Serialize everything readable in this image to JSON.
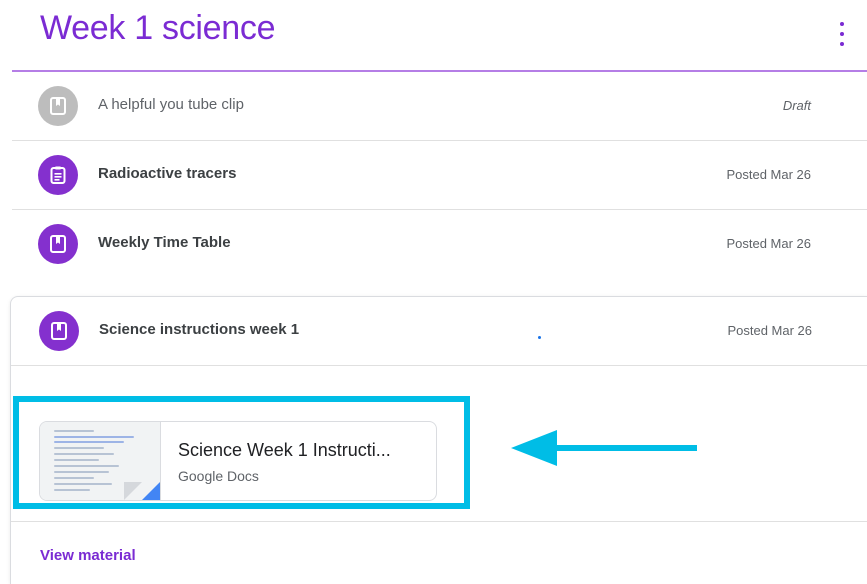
{
  "topic": {
    "title": "Week 1 science"
  },
  "items": [
    {
      "name": "A helpful you tube clip",
      "status": "Draft",
      "icon": "material-book-icon",
      "color": "#bdbdbd"
    },
    {
      "name": "Radioactive tracers",
      "status": "Posted Mar 26",
      "icon": "assignment-clipboard-icon",
      "color": "#8430ce"
    },
    {
      "name": "Weekly Time Table",
      "status": "Posted Mar 26",
      "icon": "material-book-icon",
      "color": "#8430ce"
    }
  ],
  "expanded_item": {
    "name": "Science instructions week 1",
    "status": "Posted Mar 26",
    "icon": "material-book-icon",
    "color": "#8430ce",
    "attachment": {
      "title": "Science Week 1 Instructi...",
      "type": "Google Docs",
      "icon": "google-docs-thumbnail"
    },
    "view_label": "View material"
  },
  "colors": {
    "accent": "#7b2bd3",
    "highlight": "#00bde6",
    "docs_blue": "#4285f4"
  }
}
